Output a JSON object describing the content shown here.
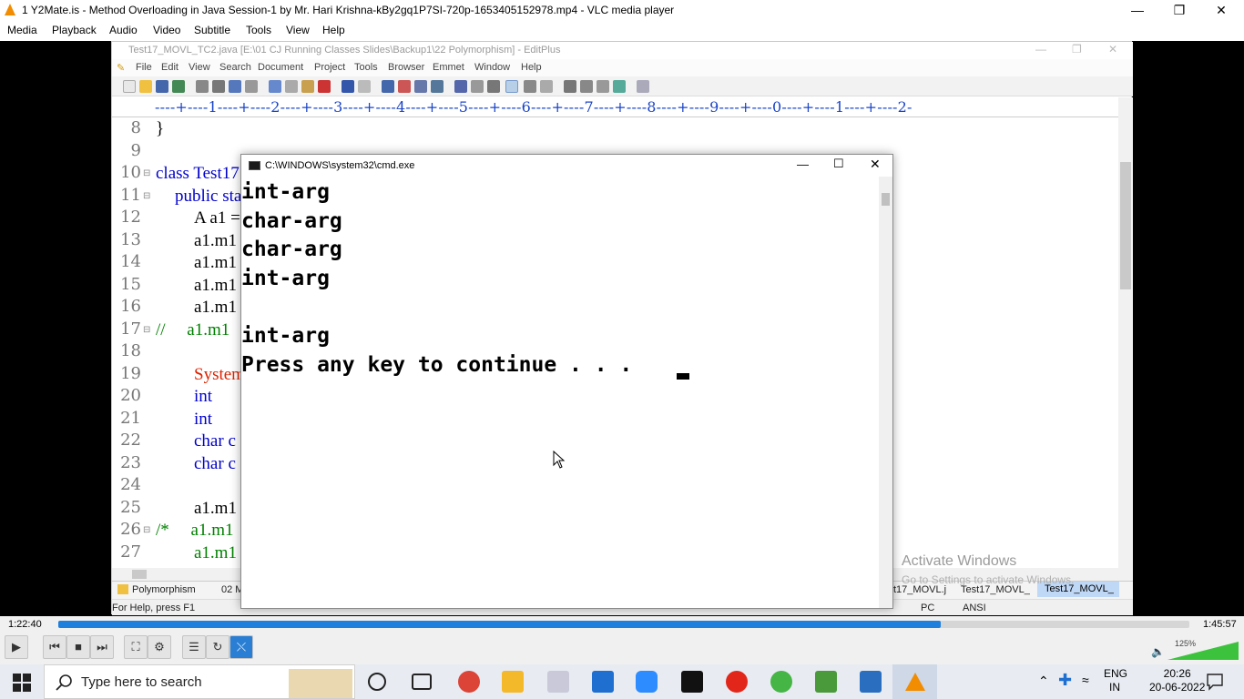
{
  "vlc": {
    "title": "1 Y2Mate.is - Method Overloading in Java  Session-1  by Mr. Hari Krishna-kBy2gq1P7SI-720p-1653405152978.mp4 - VLC media player",
    "menu": [
      "Media",
      "Playback",
      "Audio",
      "Video",
      "Subtitle",
      "Tools",
      "View",
      "Help"
    ],
    "time_elapsed": "1:22:40",
    "time_total": "1:45:57",
    "progress": 0.78,
    "volume": "125%"
  },
  "editplus": {
    "title": "Test17_MOVL_TC2.java [E:\\01 CJ Running Classes Slides\\Backup1\\22 Polymorphism] - EditPlus",
    "menu": [
      "File",
      "Edit",
      "View",
      "Search",
      "Document",
      "Project",
      "Tools",
      "Browser",
      "Emmet",
      "Window",
      "Help"
    ],
    "ruler": "----+----1----+----2----+----3----+----4----+----5----+----6----+----7----+----8----+----9----+----0----+----1----+----2-",
    "lines": [
      {
        "num": "8",
        "fold": "",
        "code": "}",
        "color": "#000000",
        "indent": 0
      },
      {
        "num": "9",
        "fold": "",
        "code": "",
        "color": "#000000",
        "indent": 0
      },
      {
        "num": "10",
        "fold": "⊟",
        "code": "class Test17",
        "color": "#0000cc",
        "indent": 0
      },
      {
        "num": "11",
        "fold": "⊟",
        "code": "public sta",
        "color": "#0000cc",
        "indent": 1
      },
      {
        "num": "12",
        "fold": "",
        "code": "A a1 =",
        "color": "#000000",
        "indent": 2
      },
      {
        "num": "13",
        "fold": "",
        "code": "a1.m1",
        "color": "#000000",
        "indent": 2
      },
      {
        "num": "14",
        "fold": "",
        "code": "a1.m1",
        "color": "#000000",
        "indent": 2
      },
      {
        "num": "15",
        "fold": "",
        "code": "a1.m1",
        "color": "#000000",
        "indent": 2
      },
      {
        "num": "16",
        "fold": "",
        "code": "a1.m1",
        "color": "#000000",
        "indent": 2
      },
      {
        "num": "17",
        "fold": "⊟",
        "code": "//     a1.m1",
        "color": "#008000",
        "indent": 0
      },
      {
        "num": "18",
        "fold": "",
        "code": "",
        "color": "#000000",
        "indent": 0
      },
      {
        "num": "19",
        "fold": "",
        "code": "System",
        "color": "#dd2200",
        "indent": 2
      },
      {
        "num": "20",
        "fold": "",
        "code": "int",
        "color": "#0000cc",
        "indent": 2
      },
      {
        "num": "21",
        "fold": "",
        "code": "int",
        "color": "#0000cc",
        "indent": 2
      },
      {
        "num": "22",
        "fold": "",
        "code": "char c",
        "color": "#0000cc",
        "indent": 2
      },
      {
        "num": "23",
        "fold": "",
        "code": "char c",
        "color": "#0000cc",
        "indent": 2
      },
      {
        "num": "24",
        "fold": "",
        "code": "",
        "color": "#000000",
        "indent": 0
      },
      {
        "num": "25",
        "fold": "",
        "code": "a1.m1",
        "color": "#000000",
        "indent": 2
      },
      {
        "num": "26",
        "fold": "⊟",
        "code": "/*     a1.m1",
        "color": "#008000",
        "indent": 0
      },
      {
        "num": "27",
        "fold": "",
        "code": "a1.m1",
        "color": "#008000",
        "indent": 2
      }
    ],
    "tabs_left": [
      "Polymorphism",
      "02 M"
    ],
    "tabs_right": [
      "t17_MOVL.j",
      "Test17_MOVL_",
      "Test17_MOVL_"
    ],
    "status_help": "For Help, press F1",
    "status_right": [
      "PC",
      "ANSI"
    ]
  },
  "cmd": {
    "title": "C:\\WINDOWS\\system32\\cmd.exe",
    "lines": [
      "int-arg",
      "char-arg",
      "char-arg",
      "int-arg",
      "",
      "int-arg",
      "Press any key to continue . . . "
    ]
  },
  "watermark": {
    "title": "Activate Windows",
    "subtitle": "Go to Settings to activate Windows."
  },
  "taskbar": {
    "search_placeholder": "Type here to search",
    "lang": "ENG",
    "region": "IN",
    "time": "20:26",
    "date": "20-06-2022"
  }
}
